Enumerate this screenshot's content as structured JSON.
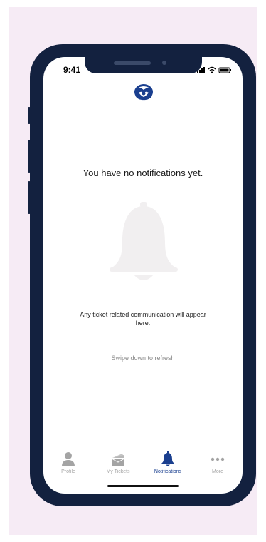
{
  "status_bar": {
    "time": "9:41"
  },
  "content": {
    "headline": "You have no notifications yet.",
    "description": "Any ticket related communication will appear here.",
    "refresh_hint": "Swipe down to refresh"
  },
  "tabbar": {
    "items": [
      {
        "label": "Profile",
        "icon": "person-icon",
        "active": false
      },
      {
        "label": "My Tickets",
        "icon": "tickets-icon",
        "active": false
      },
      {
        "label": "Notifications",
        "icon": "bell-icon",
        "active": true
      },
      {
        "label": "More",
        "icon": "more-dots-icon",
        "active": false
      }
    ]
  },
  "colors": {
    "page_background": "#f6ebf5",
    "phone_frame": "#13213f",
    "accent": "#1a3f8f",
    "inactive_tab": "#a4a4a4",
    "placeholder_bell": "#f1eff0"
  }
}
